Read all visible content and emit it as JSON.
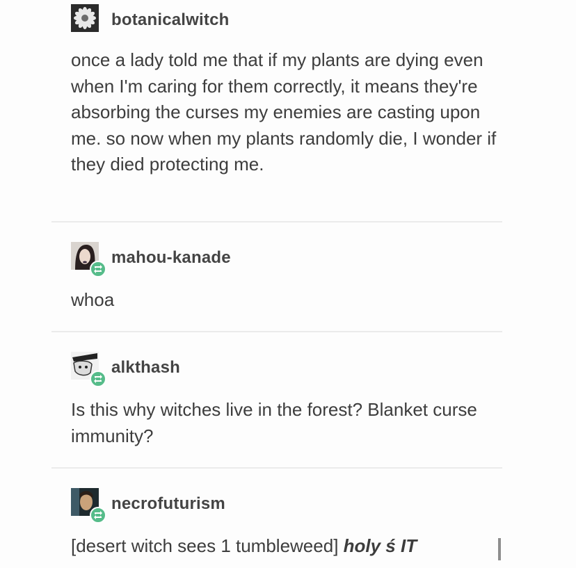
{
  "posts": [
    {
      "username": "botanicalwitch",
      "avatar_icon": "daisy-flower-icon",
      "text": "once a lady told me that if my plants are dying even when I'm caring for them correctly, it means they're absorbing the curses my enemies are casting upon me. so now when my plants randomly die, I wonder if they died protecting me."
    },
    {
      "username": "mahou-kanade",
      "avatar_icon": "person-avatar-icon",
      "badge_icon": "reblog-icon",
      "text": "whoa"
    },
    {
      "username": "alkthash",
      "avatar_icon": "character-avatar-icon",
      "badge_icon": "reblog-icon",
      "text": "Is this why witches live in the forest? Blanket curse immunity?"
    },
    {
      "username": "necrofuturism",
      "avatar_icon": "photo-avatar-icon",
      "badge_icon": "reblog-icon",
      "text_plain": "[desert witch sees 1 tumbleweed] ",
      "text_emphasis": "holy ś IT"
    }
  ],
  "colors": {
    "text": "#3d3d3d",
    "username": "#444444",
    "reblog_badge": "#56bc8a",
    "divider": "#ebebeb"
  }
}
